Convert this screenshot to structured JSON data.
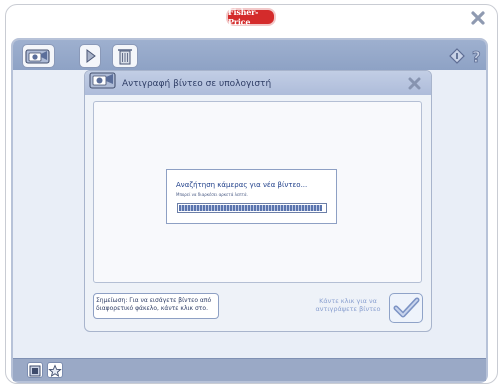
{
  "brand": {
    "logo_text": "Fisher-Price"
  },
  "toolbar": {
    "camera_icon": "camera-folder-icon",
    "play_icon": "play-icon",
    "trash_icon": "trash-icon"
  },
  "dialog": {
    "title": "Αντιγραφή βίντεο σε υπολογιστή",
    "search_title": "Αναζήτηση κάμερας για νέα βίντεο...",
    "search_subtitle": "Μπορεί να διαρκέσει αρκετά λεπτά.",
    "progress_fraction": 0.98,
    "note_line1": "Σημείωση: Για να εισάγετε βίντεο από",
    "note_line2": "διαφορετικό φάκελο, κάντε κλικ στο.",
    "click_hint_line1": "Κάντε κλικ για να",
    "click_hint_line2": "αντιγράψετε βίντεο"
  },
  "colors": {
    "brand_red": "#d42b2b",
    "toolbar_blue": "#97aacc",
    "dialog_title_text": "#2f3e66",
    "accent_text": "#1f3f8a"
  }
}
